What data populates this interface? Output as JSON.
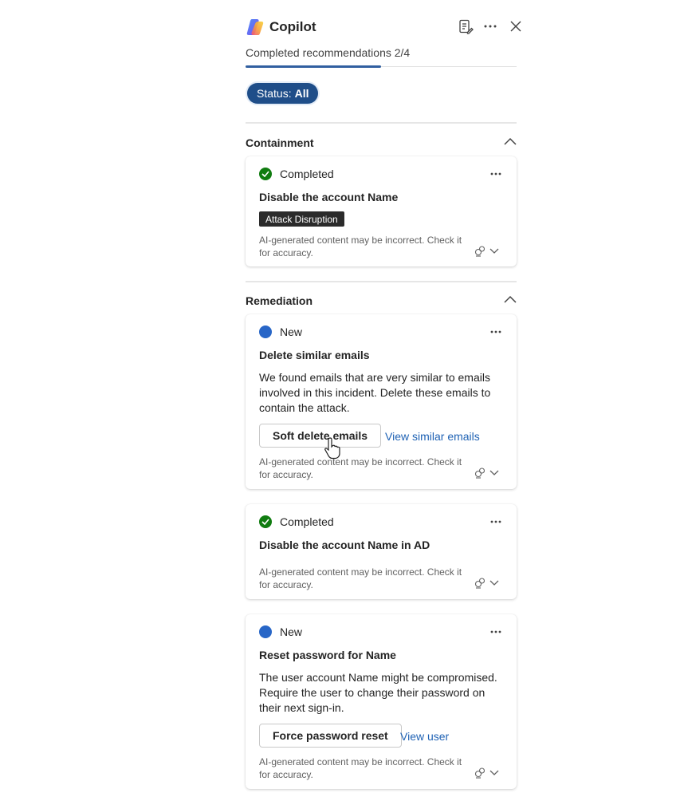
{
  "app": {
    "title": "Copilot"
  },
  "progress": {
    "label": "Completed recommendations 2/4",
    "completed": 2,
    "total": 4
  },
  "filter": {
    "prefix": "Status:",
    "value": "All"
  },
  "disclaimer": "AI-generated content may be incorrect. Check it for accuracy.",
  "colors": {
    "accent": "#1f4e89",
    "completed": "#107c10",
    "new": "#2866c7",
    "link": "#1f62b4"
  },
  "sections": [
    {
      "title": "Containment",
      "cards": [
        {
          "status": "Completed",
          "title": "Disable the account Name",
          "tag": "Attack Disruption"
        }
      ]
    },
    {
      "title": "Remediation",
      "cards": [
        {
          "status": "New",
          "title": "Delete similar emails",
          "description": "We found emails that are very similar to emails involved in this incident. Delete these emails to contain the attack.",
          "primary_action": "Soft delete emails",
          "link": "View similar emails"
        },
        {
          "status": "Completed",
          "title": "Disable the account Name in AD"
        },
        {
          "status": "New",
          "title": "Reset password for Name",
          "description": "The user account Name might be compromised. Require the user to change their password on their next sign-in.",
          "primary_action": "Force password reset",
          "link": "View user"
        }
      ]
    }
  ]
}
